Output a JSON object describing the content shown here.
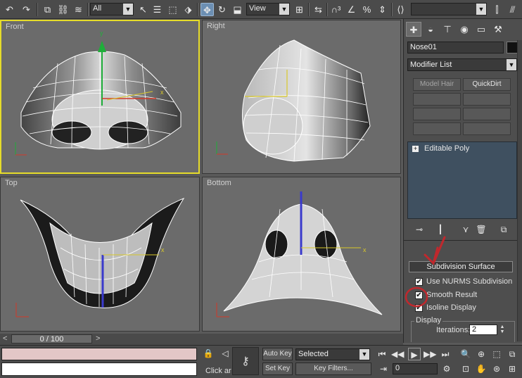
{
  "toolbar": {
    "selection_filter": "All",
    "ref_coord": "View",
    "named_selection": ""
  },
  "viewports": {
    "front": "Front",
    "right": "Right",
    "top": "Top",
    "bottom": "Bottom"
  },
  "command_panel": {
    "object_name": "Nose01",
    "modifier_list": "Modifier List",
    "buttons": [
      "Model Hair",
      "QuickDirt"
    ],
    "stack_items": [
      "Editable Poly"
    ],
    "rollout_title": "Subdivision Surface",
    "options": [
      {
        "label": "Use NURMS Subdivision",
        "checked": true
      },
      {
        "label": "Smooth Result",
        "checked": true
      },
      {
        "label": "Isoline Display",
        "checked": true
      }
    ],
    "display_group": "Display",
    "iterations_label": "Iterations:",
    "iterations_value": "2"
  },
  "timeline": {
    "frame": "0 / 100"
  },
  "bottom": {
    "auto_key": "Auto Key",
    "set_key": "Set Key",
    "key_mode": "Selected",
    "key_filters": "Key Filters...",
    "frame_value": "0",
    "prompt": "Click ar"
  },
  "colors": {
    "active_viewport_border": "#e6dc2a",
    "annotation_red": "#c0282d",
    "axis_green": "#1fae3a",
    "axis_blue": "#3a3acc",
    "axis_red": "#d03a2a"
  }
}
